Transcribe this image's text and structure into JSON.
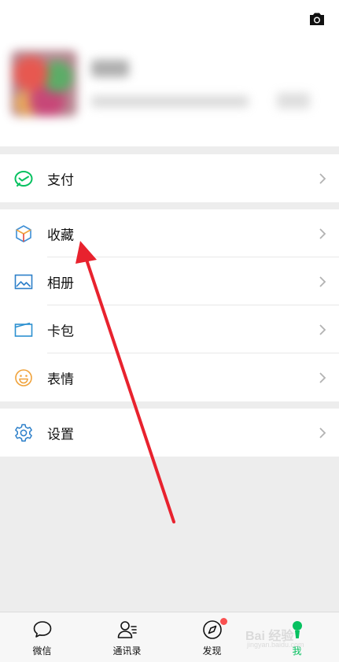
{
  "menu": {
    "pay": {
      "label": "支付",
      "icon": "wechat-pay-icon"
    },
    "favorites": {
      "label": "收藏",
      "icon": "cube-icon"
    },
    "album": {
      "label": "相册",
      "icon": "image-icon"
    },
    "cards": {
      "label": "卡包",
      "icon": "wallet-icon"
    },
    "stickers": {
      "label": "表情",
      "icon": "smiley-icon"
    },
    "settings": {
      "label": "设置",
      "icon": "gear-icon"
    }
  },
  "tabs": [
    {
      "label": "微信",
      "icon": "chat-bubble-icon"
    },
    {
      "label": "通讯录",
      "icon": "contacts-icon"
    },
    {
      "label": "发现",
      "icon": "compass-icon"
    },
    {
      "label": "我",
      "icon": "person-icon"
    }
  ],
  "colors": {
    "accent": "#07c160",
    "arrow": "#e8222e",
    "badge": "#fa5151",
    "background": "#ededed"
  },
  "watermark": {
    "text": "Bai 经验",
    "sub": "jingyan.baidu.com"
  }
}
